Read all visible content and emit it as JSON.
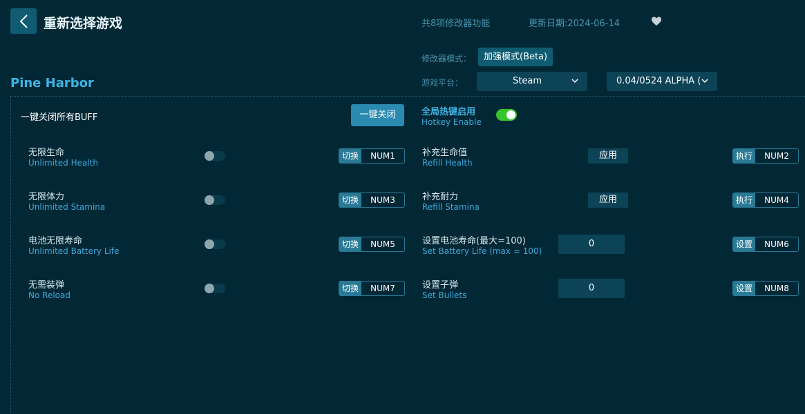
{
  "header": {
    "title": "重新选择游戏",
    "feature_count": "共8项修改器功能",
    "update_date": "更新日期:2024-06-14"
  },
  "settings": {
    "mode_label": "修改器模式：",
    "mode_value": "加强模式(Beta)",
    "platform_label": "游戏平台：",
    "platform_value": "Steam",
    "version_value": "0.04/0524 ALPHA (",
    "accent_color": "#3fb4e2",
    "toggle_on_color": "#34c62c"
  },
  "game": {
    "name": "Pine Harbor"
  },
  "panel": {
    "close_all_label": "一键关闭所有BUFF",
    "close_all_button": "一键关闭",
    "hotkey_enable_cn": "全局热键启用",
    "hotkey_enable_en": "Hotkey Enable"
  },
  "features_left": [
    {
      "cn": "无限生命",
      "en": "Unlimited Health",
      "action": "切换",
      "key": "NUM1"
    },
    {
      "cn": "无限体力",
      "en": "Unlimited Stamina",
      "action": "切换",
      "key": "NUM3"
    },
    {
      "cn": "电池无限寿命",
      "en": "Unlimited Battery Life",
      "action": "切换",
      "key": "NUM5"
    },
    {
      "cn": "无需装弹",
      "en": "No Reload",
      "action": "切换",
      "key": "NUM7"
    }
  ],
  "features_right": [
    {
      "cn": "补充生命值",
      "en": "Refill Health",
      "control": "应用",
      "action": "执行",
      "key": "NUM2"
    },
    {
      "cn": "补充耐力",
      "en": "Refill Stamina",
      "control": "应用",
      "action": "执行",
      "key": "NUM4"
    },
    {
      "cn": "设置电池寿命(最大=100)",
      "en": "Set Battery Life (max = 100)",
      "control": "0",
      "action": "设置",
      "key": "NUM6"
    },
    {
      "cn": "设置子弹",
      "en": "Set Bullets",
      "control": "0",
      "action": "设置",
      "key": "NUM8"
    }
  ]
}
